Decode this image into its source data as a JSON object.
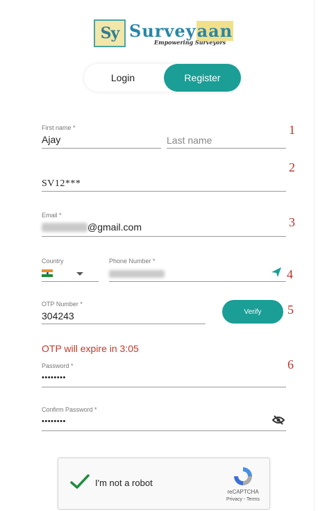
{
  "logo": {
    "mark": "Sy",
    "word_part1": "Survey",
    "word_part2": "aan",
    "tagline": "Empowering Surveyors"
  },
  "auth_tabs": {
    "login": "Login",
    "register": "Register"
  },
  "form": {
    "first_name": {
      "label": "First name *",
      "value": "Ajay"
    },
    "last_name": {
      "placeholder": "Last name"
    },
    "survey_id": {
      "value": "SV12***"
    },
    "email": {
      "label": "Email *",
      "value_suffix": "@gmail.com"
    },
    "country": {
      "label": "Country"
    },
    "phone": {
      "label": "Phone Number *"
    },
    "otp": {
      "label": "OTP Number *",
      "value": "304243"
    },
    "verify_label": "Verify",
    "otp_expiry": "OTP will expire in 3:05",
    "password": {
      "label": "Password *",
      "value": "••••••••"
    },
    "confirm_password": {
      "label": "Confirm Password *",
      "value": "••••••••"
    }
  },
  "markers": [
    "1",
    "2",
    "3",
    "4",
    "5",
    "6"
  ],
  "recaptcha": {
    "label": "I'm not a robot",
    "brand": "reCAPTCHA",
    "terms": "Privacy - Terms"
  },
  "colors": {
    "accent": "#1a9e96",
    "error": "#c0392b",
    "marker": "#b8322a"
  }
}
